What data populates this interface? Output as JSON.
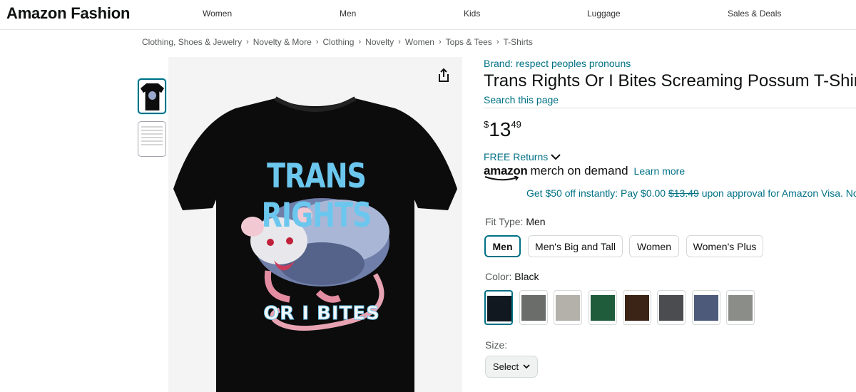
{
  "header": {
    "logo": "Amazon Fashion",
    "nav": [
      "Women",
      "Men",
      "Kids",
      "Luggage",
      "Sales & Deals"
    ]
  },
  "breadcrumb": [
    "Clothing, Shoes & Jewelry",
    "Novelty & More",
    "Clothing",
    "Novelty",
    "Women",
    "Tops & Tees",
    "T-Shirts"
  ],
  "product": {
    "brand": "Brand: respect peoples pronouns",
    "title": "Trans Rights Or I Bites Screaming Possum T-Shirt",
    "search_page": "Search this page",
    "price": {
      "symbol": "$",
      "whole": "13",
      "fraction": "49"
    },
    "returns": "FREE Returns",
    "merch_brand": "amazon",
    "merch_suffix": "merch on demand",
    "learn_more": "Learn more",
    "promo_prefix": "Get $50 off instantly: Pay $0.00",
    "promo_strike": "$13.49",
    "promo_suffix": "upon approval for Amazon Visa. No"
  },
  "shirt_art": {
    "line1": "TRANS RIGHTS",
    "line2": "OR I BITES",
    "colors": {
      "blue": "#6cc7ee",
      "pink": "#f4a6b8",
      "white": "#f7f7f7"
    }
  },
  "options": {
    "fit_label": "Fit Type:",
    "fit_value": "Men",
    "fit_types": [
      "Men",
      "Men's Big and Tall",
      "Women",
      "Women's Plus"
    ],
    "color_label": "Color:",
    "color_value": "Black",
    "colors": [
      "#111820",
      "#6b6d6b",
      "#b3b1aa",
      "#1f5c3c",
      "#3b2416",
      "#4a4c50",
      "#4d5a7a",
      "#8b8e88"
    ],
    "size_label": "Size:",
    "size_select": "Select"
  },
  "icons": [
    "share-icon",
    "chevron-down-icon"
  ]
}
